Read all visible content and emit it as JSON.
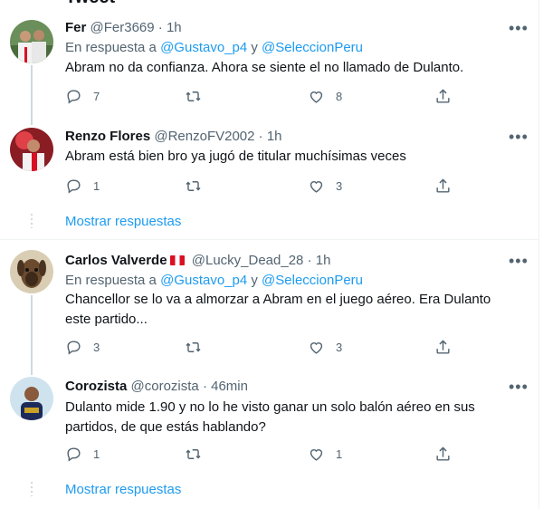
{
  "header": {
    "title": "Tweet"
  },
  "labels": {
    "in_reply_to": "En respuesta a",
    "and": "y",
    "show_replies": "Mostrar respuestas"
  },
  "colors": {
    "accent": "#1d9bf0",
    "secondary_text": "#536471",
    "primary_text": "#0f1419"
  },
  "tweets": [
    {
      "name": "Fer",
      "handle": "@Fer3669",
      "time": "1h",
      "reply_to": [
        "@Gustavo_p4",
        "@SeleccionPeru"
      ],
      "text": "Abram no da confianza. Ahora se siente el no llamado de Dulanto.",
      "replies": "7",
      "retweets": "",
      "likes": "8"
    },
    {
      "name": "Renzo Flores",
      "handle": "@RenzoFV2002",
      "time": "1h",
      "text": "Abram está bien bro ya jugó de titular muchísimas veces",
      "replies": "1",
      "retweets": "",
      "likes": "3"
    },
    {
      "name": "Carlos Valverde",
      "handle": "@Lucky_Dead_28",
      "time": "1h",
      "flag": "peru-flag",
      "reply_to": [
        "@Gustavo_p4",
        "@SeleccionPeru"
      ],
      "text": "Chancellor se lo va a almorzar a Abram en el juego aéreo. Era Dulanto este partido...",
      "replies": "3",
      "retweets": "",
      "likes": "3"
    },
    {
      "name": "Corozista",
      "handle": "@corozista",
      "time": "46min",
      "text": "Dulanto mide 1.90 y no lo he visto ganar un solo balón aéreo en sus partidos, de que estás hablando?",
      "replies": "1",
      "retweets": "",
      "likes": "1"
    }
  ],
  "icons": [
    "more-icon",
    "reply-icon",
    "retweet-icon",
    "like-icon",
    "share-icon"
  ]
}
